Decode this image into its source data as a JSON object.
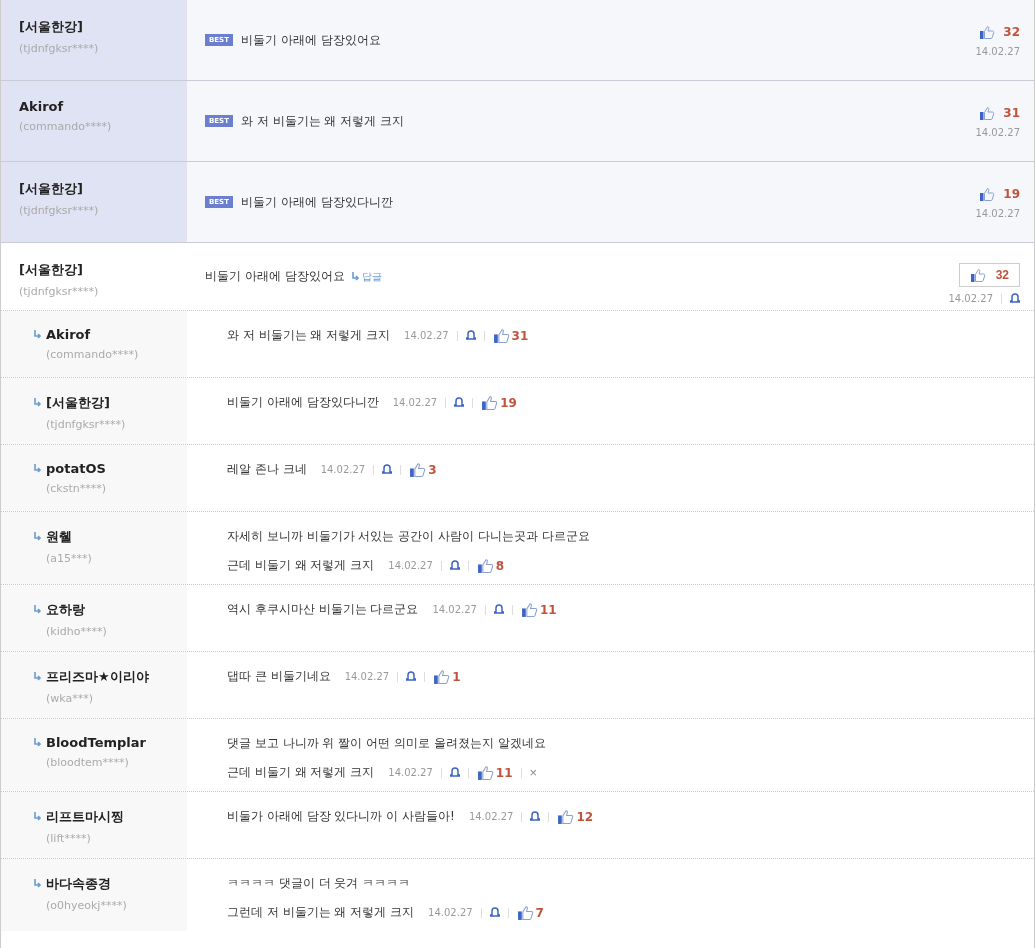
{
  "best_comments": [
    {
      "author": "[서울한강]",
      "user_id": "(tjdnfgksr****)",
      "badge": "BEST",
      "text": "비둘기 아래에 담장있어요",
      "likes": "32",
      "date": "14.02.27"
    },
    {
      "author": "Akirof",
      "user_id": "(commando****)",
      "badge": "BEST",
      "text": "와 저 비둘기는 왜 저렇게 크지",
      "likes": "31",
      "date": "14.02.27"
    },
    {
      "author": "[서울한강]",
      "user_id": "(tjdnfgksr****)",
      "badge": "BEST",
      "text": "비둘기 아래에 담장있다니깐",
      "likes": "19",
      "date": "14.02.27"
    }
  ],
  "comment": {
    "author": "[서울한강]",
    "user_id": "(tjdnfgksr****)",
    "text": "비둘기 아래에 담장있어요",
    "reply_link": "답글",
    "likes": "32",
    "date": "14.02.27"
  },
  "replies": [
    {
      "author": "Akirof",
      "user_id": "(commando****)",
      "lines": [
        "와 저 비둘기는 왜 저렇게 크지"
      ],
      "date": "14.02.27",
      "likes": "31"
    },
    {
      "author": "[서울한강]",
      "user_id": "(tjdnfgksr****)",
      "lines": [
        "비둘기 아래에 담장있다니깐"
      ],
      "date": "14.02.27",
      "likes": "19"
    },
    {
      "author": "potatOS",
      "user_id": "(ckstn****)",
      "lines": [
        "레알 존나 크네"
      ],
      "date": "14.02.27",
      "likes": "3"
    },
    {
      "author": "원췔",
      "user_id": "(a15***)",
      "lines": [
        "자세히 보니까 비둘기가 서있는 공간이 사람이 다니는곳과 다르군요",
        "근데 비둘기 왜 저렇게 크지"
      ],
      "date": "14.02.27",
      "likes": "8"
    },
    {
      "author": "요하랑",
      "user_id": "(kidho****)",
      "lines": [
        "역시 후쿠시마산 비둘기는 다르군요"
      ],
      "date": "14.02.27",
      "likes": "11"
    },
    {
      "author": "프리즈마★이리야",
      "user_id": "(wka***)",
      "lines": [
        "댑따 큰 비둘기네요"
      ],
      "date": "14.02.27",
      "likes": "1"
    },
    {
      "author": "BloodTemplar",
      "user_id": "(bloodtem****)",
      "lines": [
        "댓글 보고 나니까 위 짤이 어떤 의미로 올려졌는지 알겠네요",
        "근데 비둘기 왜 저렇게 크지"
      ],
      "date": "14.02.27",
      "likes": "11",
      "delete": "×"
    },
    {
      "author": "리프트마시찡",
      "user_id": "(lift****)",
      "lines": [
        "비둘가 아래에 담장 있다니까 이 사람들아!"
      ],
      "date": "14.02.27",
      "likes": "12"
    },
    {
      "author": "바다속종경",
      "user_id": "(o0hyeokj****)",
      "lines": [
        "ㅋㅋㅋㅋ 댓글이 더 웃겨 ㅋㅋㅋㅋ",
        "그런데 저 비둘기는 왜 저렇게 크지"
      ],
      "date": "14.02.27",
      "likes": "7"
    }
  ]
}
